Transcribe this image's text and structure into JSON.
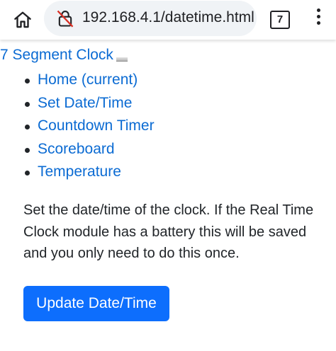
{
  "browser": {
    "url": "192.168.4.1/datetime.html",
    "tab_count": "7",
    "icons": {
      "home": "home-icon",
      "security": "not-secure-lock-icon",
      "menu": "more-vert-icon"
    }
  },
  "page": {
    "brand": "7 Segment Clock",
    "nav": [
      {
        "label": "Home (current)"
      },
      {
        "label": "Set Date/Time"
      },
      {
        "label": "Countdown Timer"
      },
      {
        "label": "Scoreboard"
      },
      {
        "label": "Temperature"
      }
    ],
    "description": "Set the date/time of the clock. If the Real Time Clock module has a battery this will be saved and you only need to do this once.",
    "update_button": "Update Date/Time"
  },
  "colors": {
    "link": "#0b6bd3",
    "primary_button": "#0d6efd",
    "text": "#212529",
    "urlbar_bg": "#f0f3f6",
    "insecure_slash": "#d93025"
  }
}
